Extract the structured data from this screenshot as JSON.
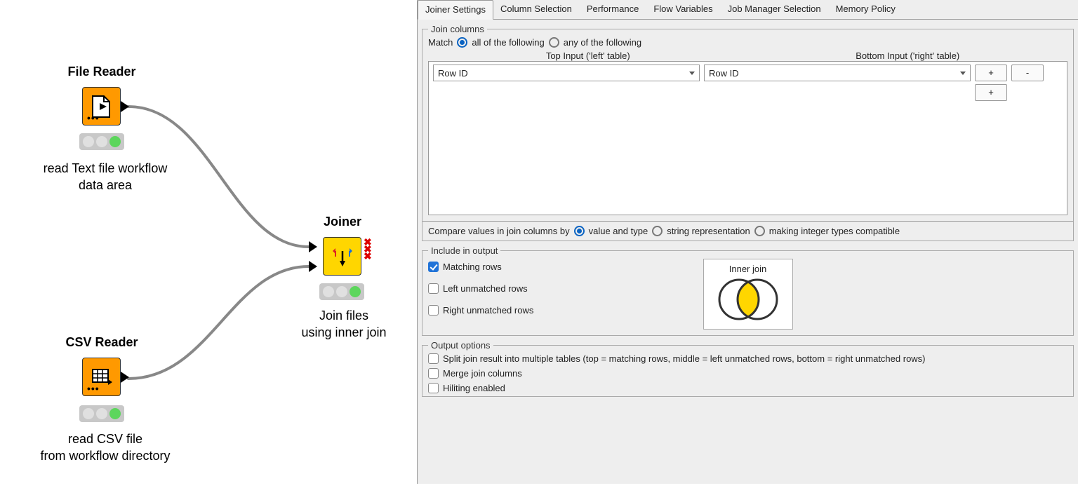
{
  "workflow": {
    "nodes": {
      "fileReader": {
        "title": "File Reader",
        "desc": "read Text file workflow\ndata area"
      },
      "csvReader": {
        "title": "CSV Reader",
        "desc": "read CSV file\nfrom workflow directory"
      },
      "joiner": {
        "title": "Joiner",
        "desc": "Join files\nusing inner join"
      }
    }
  },
  "dialog": {
    "tabs": [
      "Joiner Settings",
      "Column Selection",
      "Performance",
      "Flow Variables",
      "Job Manager Selection",
      "Memory Policy"
    ],
    "joinColumns": {
      "legend": "Join columns",
      "matchLabel": "Match",
      "radioAll": "all of the following",
      "radioAny": "any of the following",
      "headerLeft": "Top Input ('left' table)",
      "headerRight": "Bottom Input ('right' table)",
      "leftValue": "Row ID",
      "rightValue": "Row ID",
      "plus": "+",
      "minus": "-",
      "compareLabel": "Compare values in join columns by",
      "cmpValueType": "value and type",
      "cmpString": "string representation",
      "cmpInteger": "making integer types compatible"
    },
    "includeOutput": {
      "legend": "Include in output",
      "matching": "Matching rows",
      "leftUnmatched": "Left unmatched rows",
      "rightUnmatched": "Right unmatched rows",
      "vennLabel": "Inner join"
    },
    "outputOptions": {
      "legend": "Output options",
      "split": "Split join result into multiple tables (top = matching rows, middle = left unmatched rows, bottom = right unmatched rows)",
      "merge": "Merge join columns",
      "hilite": "Hiliting enabled"
    }
  }
}
